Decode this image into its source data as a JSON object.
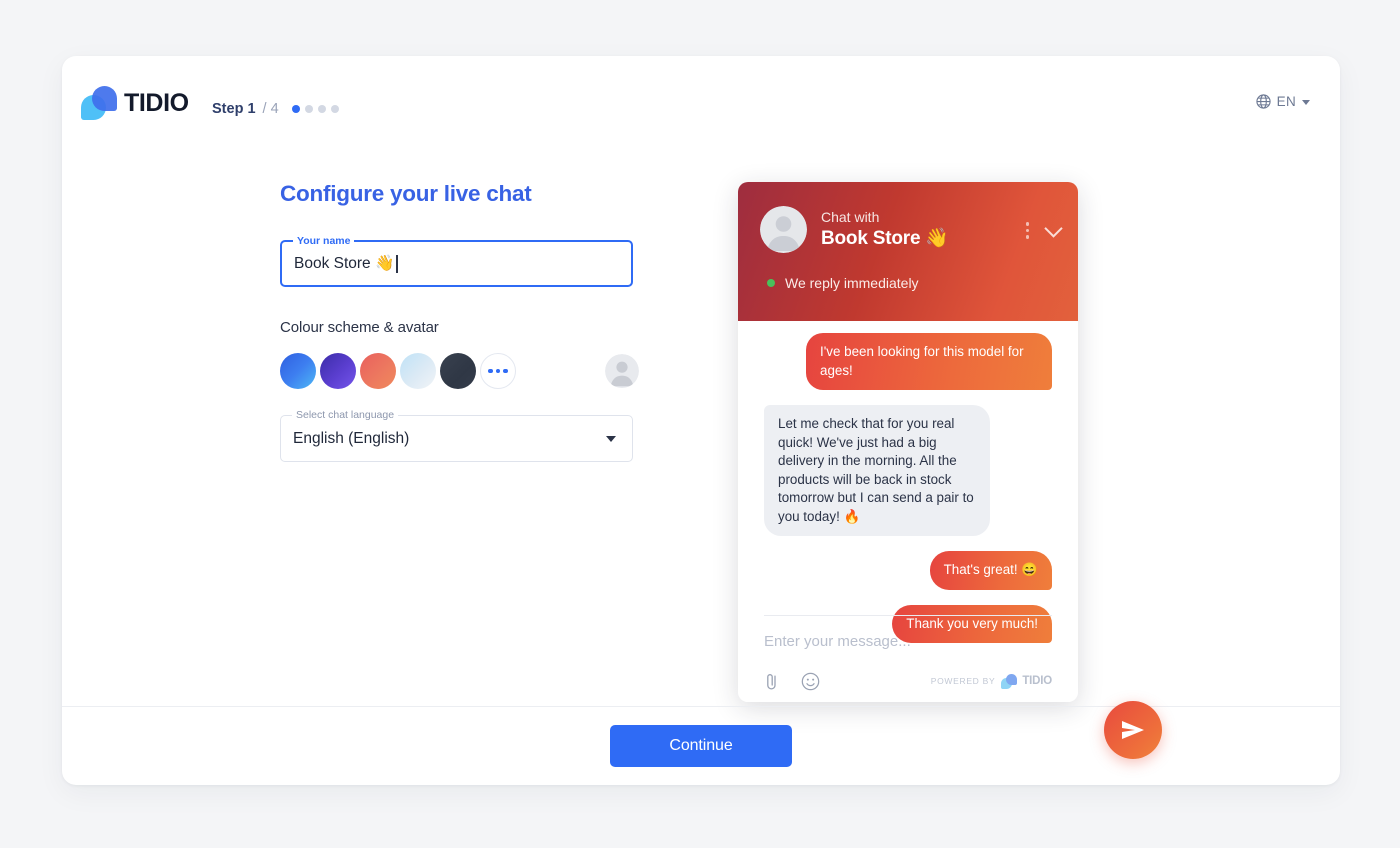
{
  "page": {
    "background": "#f4f5f7",
    "card_background": "#ffffff"
  },
  "header": {
    "brand_name": "TIDIO",
    "logo_icon": "tidio-logo-icon",
    "step_current": "Step 1",
    "step_total": "/ 4",
    "step_dots_total": 4,
    "step_dots_active": 1,
    "language": {
      "globe_icon": "globe-icon",
      "code": "EN",
      "caret_icon": "chevron-down-icon"
    }
  },
  "form": {
    "title": "Configure your live chat",
    "name_field": {
      "label": "Your name",
      "value": "Book Store 👋",
      "focused": true
    },
    "scheme_section_label": "Colour scheme & avatar",
    "swatches": [
      {
        "name": "swatch-blue",
        "gradient": "linear-gradient(135deg, #2f5fe0 0%, #3d7ef0 50%, #4eb8f5 100%)",
        "selected": true
      },
      {
        "name": "swatch-purple",
        "gradient": "linear-gradient(135deg, #3b2ca8 0%, #5b3fd0 55%, #7455ea 100%)",
        "selected": false
      },
      {
        "name": "swatch-coral",
        "gradient": "linear-gradient(135deg, #e9605e 0%, #ed7a5f 60%, #f0895c 100%)",
        "selected": false
      },
      {
        "name": "swatch-light-blue",
        "gradient": "linear-gradient(135deg, #bfe2f6 0%, #dceaf5 55%, #f1f4f7 100%)",
        "selected": false
      },
      {
        "name": "swatch-dark",
        "gradient": "linear-gradient(135deg, #39414f 0%, #2f3745 60%, #343c4a 100%)",
        "selected": false
      }
    ],
    "more_colours_label": "more-colours",
    "avatar_icon": "avatar-placeholder-icon",
    "language_field": {
      "label": "Select chat language",
      "value": "English (English)",
      "caret_icon": "chevron-down-icon"
    }
  },
  "chat_widget": {
    "header": {
      "avatar_icon": "avatar-placeholder-icon",
      "chat_with_label": "Chat with",
      "store_name": "Book Store 👋",
      "kebab_icon": "more-vertical-icon",
      "minimize_icon": "chevron-down-icon",
      "status_text": "We reply immediately",
      "status_color": "#49c15b",
      "gradient": "linear-gradient(110deg, #9e2d3f 0%, #c0392f 42%, #e0553a 78%, #e2613c 100%)"
    },
    "messages": [
      {
        "direction": "out",
        "text": "I've been looking for this model for ages!",
        "shape": "block"
      },
      {
        "direction": "in",
        "text": "Let me check that for you real quick! We've just had a big delivery in the morning. All the products will be back in stock tomorrow but I can send a pair to you today! 🔥",
        "shape": "block"
      },
      {
        "direction": "out",
        "text": "That's great! 😄",
        "shape": "pill"
      },
      {
        "direction": "out",
        "text": "Thank you very much!",
        "shape": "pill"
      }
    ],
    "input_placeholder": "Enter your message...",
    "attach_icon": "paperclip-icon",
    "emoji_icon": "smiley-icon",
    "powered_by_text": "POWERED BY",
    "powered_by_brand": "TIDIO",
    "send_button_icon": "send-icon"
  },
  "footer": {
    "continue_label": "Continue",
    "continue_color": "#2f6bf5"
  }
}
